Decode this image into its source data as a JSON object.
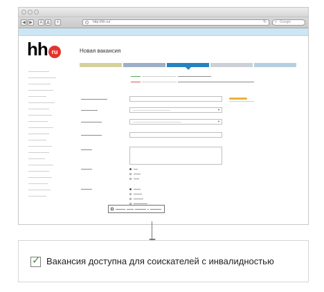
{
  "browser": {
    "nav_back": "◀",
    "nav_forward": "▶",
    "text_smaller": "A",
    "text_larger": "A",
    "add_tab": "+",
    "url": "http://hh.ru/",
    "reload_icon": "↻",
    "search_placeholder": "Google",
    "search_icon": "⌕"
  },
  "logo": {
    "text": "hh",
    "badge": "ru"
  },
  "page": {
    "title": "Новая вакансия"
  },
  "steps_colors": [
    "#d6d09a",
    "#9bb0c8",
    "#2582c0",
    "#cbd1d6",
    "#b6cfe0"
  ],
  "accent_color": "#e8b23a",
  "callout_checkbox": {
    "label": "Вакансия доступна для соискателей с инвалидностью",
    "checked": true,
    "check_color": "#3c9a2e"
  }
}
